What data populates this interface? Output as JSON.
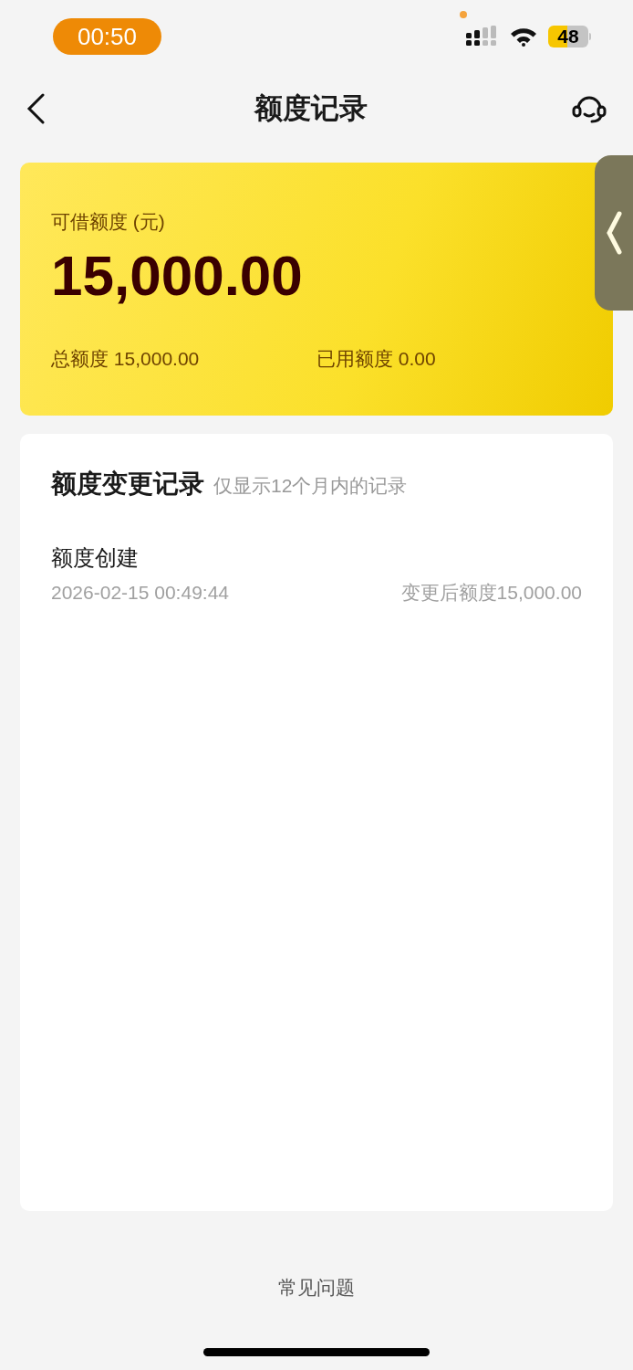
{
  "status_bar": {
    "time": "00:50",
    "battery": "48"
  },
  "nav": {
    "title": "额度记录"
  },
  "credit_card": {
    "label": "可借额度 (元)",
    "amount": "15,000.00",
    "total": "总额度 15,000.00",
    "used": "已用额度 0.00"
  },
  "records": {
    "title": "额度变更记录",
    "note": "仅显示12个月内的记录",
    "items": [
      {
        "name": "额度创建",
        "time": "2026-02-15 00:49:44",
        "result": "变更后额度15,000.00"
      }
    ]
  },
  "footer_link": "常见问题"
}
